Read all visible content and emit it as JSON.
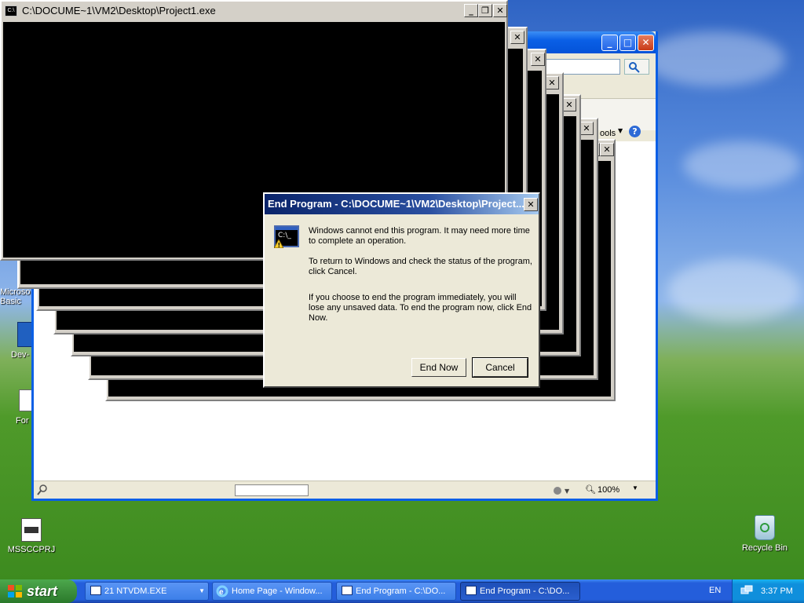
{
  "desktop": {
    "icons": [
      {
        "label": "Microso\nBasic",
        "id": "microsoft-basic"
      },
      {
        "label": "Dev-",
        "id": "dev"
      },
      {
        "label": "For",
        "id": "form"
      },
      {
        "label": "MSSCCPRJ",
        "id": "mssccprj"
      },
      {
        "label": "Recycle Bin",
        "id": "recycle-bin"
      }
    ]
  },
  "explorer": {
    "tools_label": "ools",
    "zoom": "100%"
  },
  "console": {
    "title": "C:\\DOCUME~1\\VM2\\Desktop\\Project1.exe",
    "icon_text": "C:\\"
  },
  "dialog": {
    "title": "End Program - C:\\DOCUME~1\\VM2\\Desktop\\Project...",
    "icon_text": "C:\\_",
    "message1": "Windows cannot end this program. It may need more time to complete an operation.",
    "message2": "To return to Windows and check the status of the program, click Cancel.",
    "message3": "If you choose to end the program immediately, you will lose any unsaved data. To end the program now, click End Now.",
    "end_now_label": "End Now",
    "cancel_label": "Cancel"
  },
  "taskbar": {
    "start_label": "start",
    "buttons": [
      {
        "label": "21 NTVDM.EXE"
      },
      {
        "label": "Home Page - Window..."
      },
      {
        "label": "End Program - C:\\DO..."
      },
      {
        "label": "End Program - C:\\DO..."
      }
    ],
    "language": "EN",
    "clock": "3:37 PM"
  }
}
